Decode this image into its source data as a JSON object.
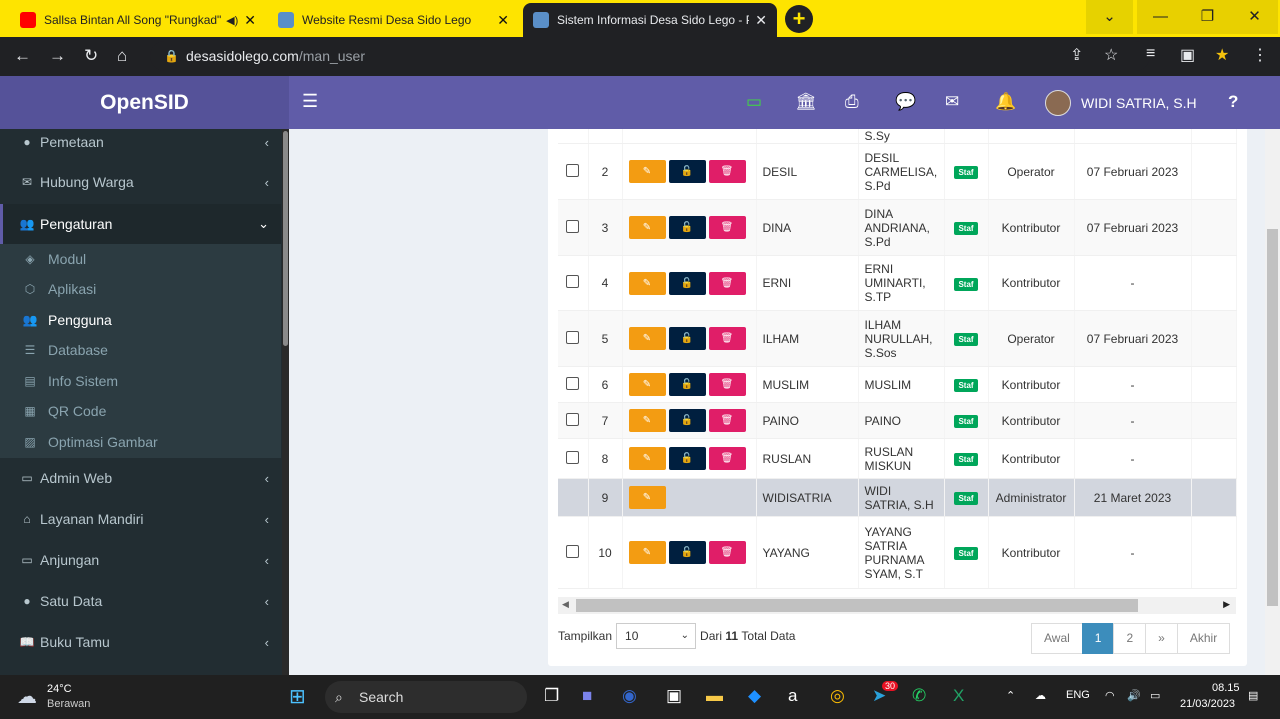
{
  "browser": {
    "tabs": [
      {
        "title": "Sallsa Bintan All Song \"Rungkad\"",
        "active": false
      },
      {
        "title": "Website Resmi Desa Sido Lego",
        "active": false
      },
      {
        "title": "Sistem Informasi Desa Sido Lego - Pengguna",
        "active": true
      }
    ],
    "url_domain": "desasidolego.com",
    "url_path": "/man_user"
  },
  "app": {
    "brand": "OpenSID",
    "user_name": "WIDI SATRIA, S.H"
  },
  "sidebar": {
    "items": [
      {
        "label": "Pemetaan",
        "icon": "globe-icon",
        "chevron": "‹"
      },
      {
        "label": "Hubung Warga",
        "icon": "envelope-icon",
        "chevron": "‹"
      },
      {
        "label": "Pengaturan",
        "icon": "users-icon",
        "chevron": "⌄"
      },
      {
        "label": "Admin Web",
        "icon": "desktop-icon",
        "chevron": "‹"
      },
      {
        "label": "Layanan Mandiri",
        "icon": "inbox-icon",
        "chevron": "‹"
      },
      {
        "label": "Anjungan",
        "icon": "monitor-icon",
        "chevron": "‹"
      },
      {
        "label": "Satu Data",
        "icon": "globe-icon",
        "chevron": "‹"
      },
      {
        "label": "Buku Tamu",
        "icon": "book-icon",
        "chevron": "‹"
      }
    ],
    "subitems": [
      {
        "label": "Modul"
      },
      {
        "label": "Aplikasi"
      },
      {
        "label": "Pengguna"
      },
      {
        "label": "Database"
      },
      {
        "label": "Info Sistem"
      },
      {
        "label": "QR Code"
      },
      {
        "label": "Optimasi Gambar"
      }
    ]
  },
  "table": {
    "partial_top": "S.Sy",
    "rows": [
      {
        "no": "2",
        "username": "DESIL",
        "name_lines": [
          "DESIL",
          "CARMELISA,",
          "S.Pd"
        ],
        "badge": "Staf",
        "group": "Operator",
        "date": "07 Februari 2023"
      },
      {
        "no": "3",
        "username": "DINA",
        "name_lines": [
          "DINA",
          "ANDRIANA,",
          "S.Pd"
        ],
        "badge": "Staf",
        "group": "Kontributor",
        "date": "07 Februari 2023"
      },
      {
        "no": "4",
        "username": "ERNI",
        "name_lines": [
          "ERNI",
          "UMINARTI,",
          "S.TP"
        ],
        "badge": "Staf",
        "group": "Kontributor",
        "date": "-"
      },
      {
        "no": "5",
        "username": "ILHAM",
        "name_lines": [
          "ILHAM",
          "NURULLAH,",
          "S.Sos"
        ],
        "badge": "Staf",
        "group": "Operator",
        "date": "07 Februari 2023"
      },
      {
        "no": "6",
        "username": "MUSLIM",
        "name_lines": [
          "MUSLIM"
        ],
        "badge": "Staf",
        "group": "Kontributor",
        "date": "-"
      },
      {
        "no": "7",
        "username": "PAINO",
        "name_lines": [
          "PAINO"
        ],
        "badge": "Staf",
        "group": "Kontributor",
        "date": "-"
      },
      {
        "no": "8",
        "username": "RUSLAN",
        "name_lines": [
          "RUSLAN",
          "MISKUN"
        ],
        "badge": "Staf",
        "group": "Kontributor",
        "date": "-"
      },
      {
        "no": "9",
        "username": "WIDISATRIA",
        "name_lines": [
          "WIDI",
          "SATRIA, S.H"
        ],
        "badge": "Staf",
        "group": "Administrator",
        "date": "21 Maret 2023"
      },
      {
        "no": "10",
        "username": "YAYANG",
        "name_lines": [
          "YAYANG",
          "SATRIA",
          "PURNAMA",
          "SYAM, S.T"
        ],
        "badge": "Staf",
        "group": "Kontributor",
        "date": "-"
      }
    ]
  },
  "footer": {
    "show_label": "Tampilkan",
    "page_size": "10",
    "total_prefix": "Dari",
    "total_count": "11",
    "total_suffix": "Total Data",
    "pagination": [
      "Awal",
      "1",
      "2",
      "»",
      "Akhir"
    ]
  },
  "taskbar": {
    "temp": "24°C",
    "weather": "Berawan",
    "search_label": "Search",
    "telegram_badge": "30",
    "lang": "ENG",
    "time": "08.15",
    "date": "21/03/2023"
  }
}
